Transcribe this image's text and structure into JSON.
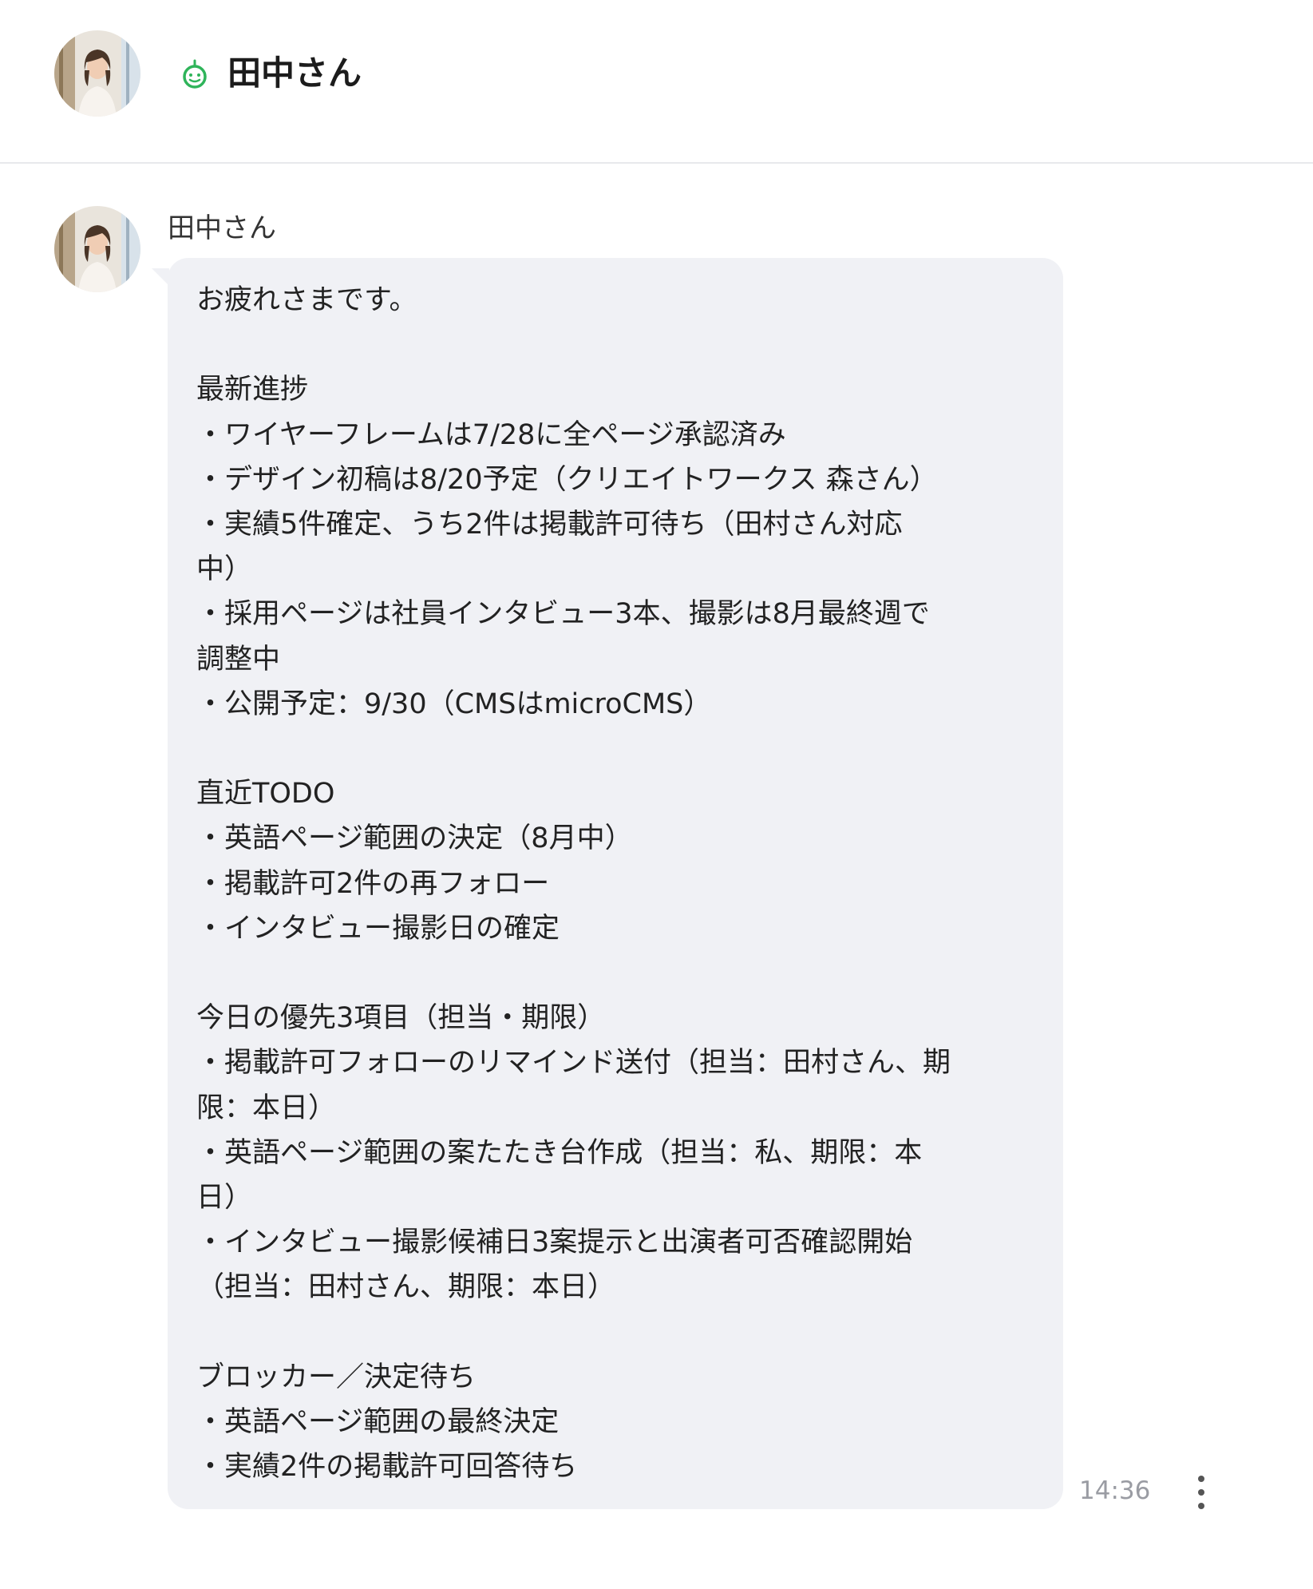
{
  "header": {
    "name": "田中さん",
    "status_icon": "bot-icon",
    "status_color": "#2fb45a"
  },
  "message": {
    "sender": "田中さん",
    "text": "お疲れさまです。\n\n最新進捗\n・ワイヤーフレームは7/28に全ページ承認済み\n・デザイン初稿は8/20予定（クリエイトワークス 森さん）\n・実績5件確定、うち2件は掲載許可待ち（田村さん対応\n中）\n・採用ページは社員インタビュー3本、撮影は8月最終週で\n調整中\n・公開予定：9/30（CMSはmicroCMS）\n\n直近TODO\n・英語ページ範囲の決定（8月中）\n・掲載許可2件の再フォロー\n・インタビュー撮影日の確定\n\n今日の優先3項目（担当・期限）\n・掲載許可フォローのリマインド送付（担当：田村さん、期\n限：本日）\n・英語ページ範囲の案たたき台作成（担当：私、期限：本\n日）\n・インタビュー撮影候補日3案提示と出演者可否確認開始\n（担当：田村さん、期限：本日）\n\nブロッカー／決定待ち\n・英語ページ範囲の最終決定\n・実績2件の掲載許可回答待ち",
    "time": "14:36",
    "bubble_color": "#f0f1f5"
  }
}
